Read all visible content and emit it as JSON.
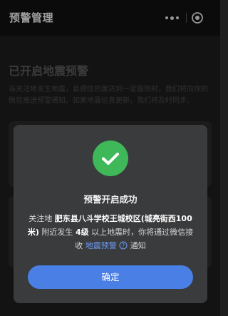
{
  "header": {
    "title": "预警管理",
    "more_icon": "more-dots-icon",
    "close_icon": "target-circle-icon"
  },
  "page": {
    "heading": "已开启地震预警",
    "description": "当关注地发生地震，且预估烈度达到一定级别时，我们将向你的微信推送预警通知。如果地震信息更新，我们将及时同步。"
  },
  "dialog": {
    "icon": "success-check-icon",
    "title": "预警开启成功",
    "msg_prefix": "关注地",
    "location": "肥东县八斗学校王城校区(城亮街西100米)",
    "msg_mid": "附近发生",
    "level": "4级",
    "msg_suffix": "以上地震时，你将通过微信接收",
    "link_text": "地震预警",
    "msg_end": "通知",
    "confirm_label": "确定"
  },
  "colors": {
    "success": "#3fb85a",
    "primary_button": "#4a7fe6",
    "link": "#6d9cf5"
  }
}
